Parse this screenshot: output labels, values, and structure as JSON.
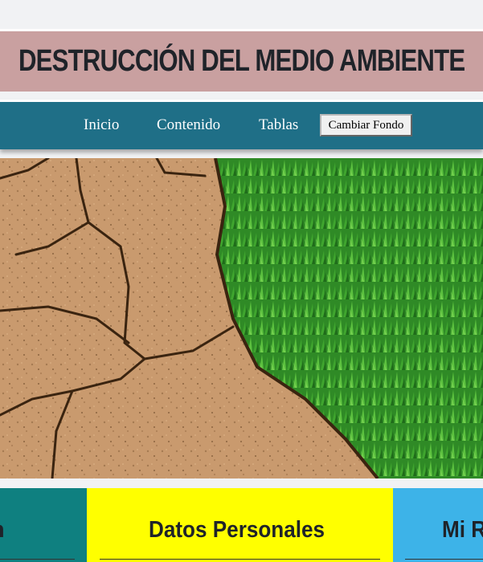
{
  "header": {
    "title": "DESTRUCCIÓN DEL MEDIO AMBIENTE"
  },
  "nav": {
    "links": [
      "Inicio",
      "Contenido",
      "Tablas"
    ],
    "button_label": "Cambiar Fondo"
  },
  "hero": {
    "image": "dry-cracked-soil-and-green-grass"
  },
  "cards": [
    {
      "title": "n",
      "color": "#0f8080"
    },
    {
      "title": "Datos Personales",
      "color": "#ffff00"
    },
    {
      "title": "Mi R",
      "color": "#3db3e8"
    }
  ],
  "colors": {
    "page_bg": "#f1f2f4",
    "header_bg": "#c9a0a0",
    "nav_bg": "#1f6f87"
  }
}
